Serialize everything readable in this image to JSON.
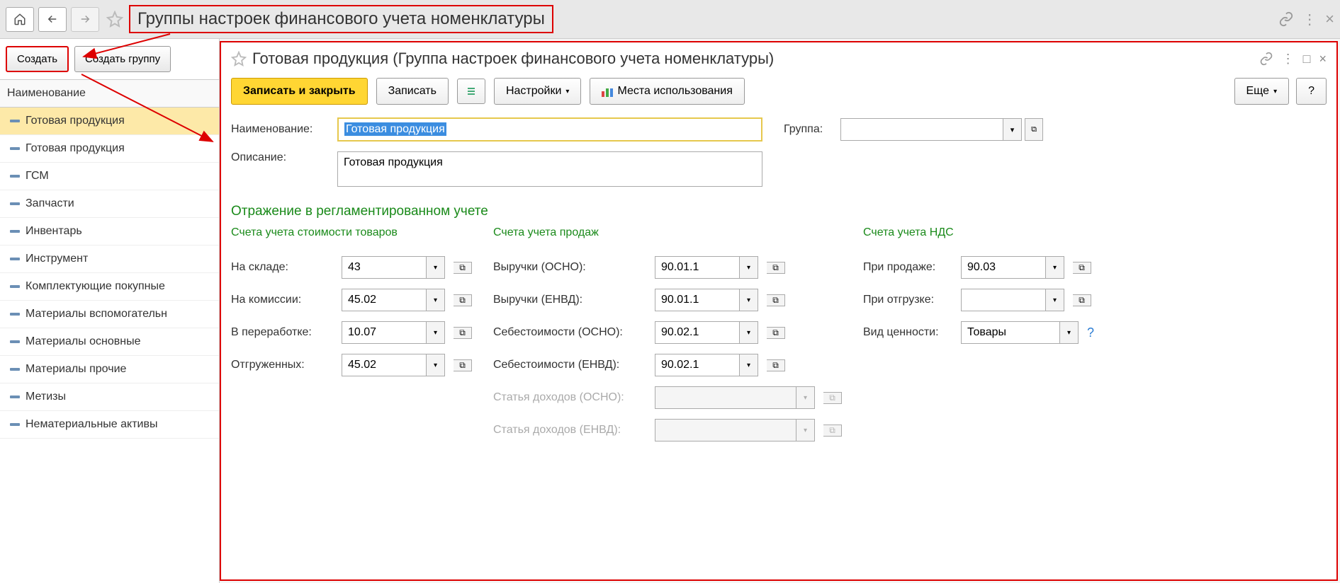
{
  "topbar": {
    "page_title": "Группы настроек финансового учета номенклатуры"
  },
  "leftPanel": {
    "create_btn": "Создать",
    "create_group_btn": "Создать группу",
    "header": "Наименование",
    "items": [
      "Готовая продукция",
      "Готовая продукция",
      "ГСМ",
      "Запчасти",
      "Инвентарь",
      "Инструмент",
      "Комплектующие покупные",
      "Материалы вспомогательн",
      "Материалы основные",
      "Материалы прочие",
      "Метизы",
      "Нематериальные активы"
    ]
  },
  "rightPanel": {
    "title": "Готовая продукция (Группа настроек финансового учета номенклатуры)",
    "toolbar": {
      "save_close": "Записать и закрыть",
      "save": "Записать",
      "settings": "Настройки",
      "usage": "Места использования",
      "more": "Еще",
      "help": "?"
    },
    "fields": {
      "name_label": "Наименование:",
      "name_value": "Готовая продукция",
      "group_label": "Группа:",
      "group_value": "",
      "desc_label": "Описание:",
      "desc_value": "Готовая продукция"
    },
    "sections": {
      "main_title": "Отражение в регламентированном учете",
      "cost_title": "Счета учета стоимости товаров",
      "sales_title": "Счета учета продаж",
      "vat_title": "Счета учета НДС"
    },
    "cost": {
      "on_stock_label": "На складе:",
      "on_stock": "43",
      "on_commission_label": "На комиссии:",
      "on_commission": "45.02",
      "in_processing_label": "В переработке:",
      "in_processing": "10.07",
      "shipped_label": "Отгруженных:",
      "shipped": "45.02"
    },
    "sales": {
      "revenue_osno_label": "Выручки (ОСНО):",
      "revenue_osno": "90.01.1",
      "revenue_envd_label": "Выручки (ЕНВД):",
      "revenue_envd": "90.01.1",
      "cost_osno_label": "Себестоимости (ОСНО):",
      "cost_osno": "90.02.1",
      "cost_envd_label": "Себестоимости (ЕНВД):",
      "cost_envd": "90.02.1",
      "income_osno_label": "Статья доходов (ОСНО):",
      "income_osno": "",
      "income_envd_label": "Статья доходов (ЕНВД):",
      "income_envd": ""
    },
    "vat": {
      "on_sale_label": "При продаже:",
      "on_sale": "90.03",
      "on_shipment_label": "При отгрузке:",
      "on_shipment": "",
      "value_type_label": "Вид ценности:",
      "value_type": "Товары"
    }
  }
}
